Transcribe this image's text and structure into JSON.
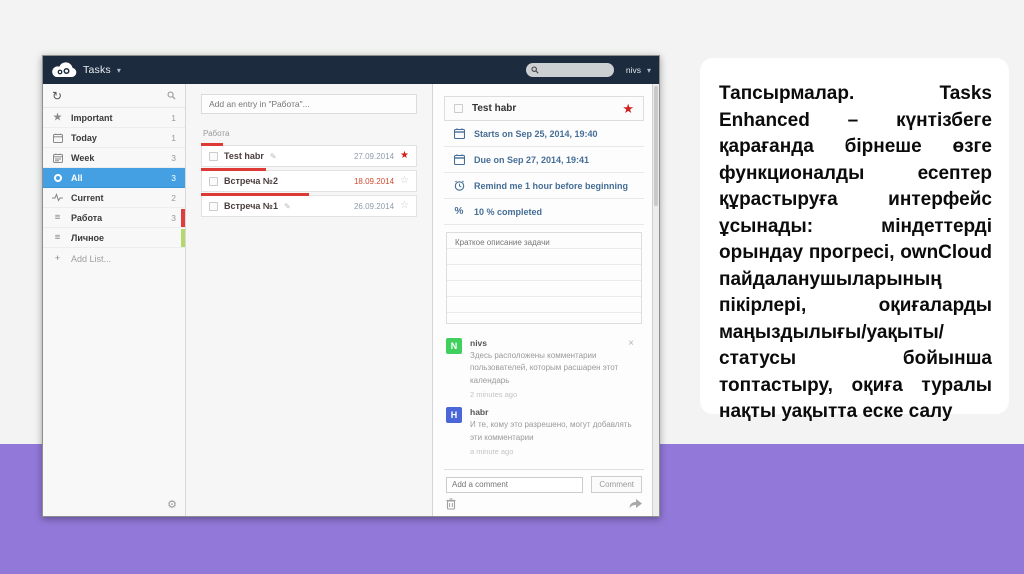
{
  "slide": {
    "description_text": "Тапсырмалар. Tasks Enhanced – күнтізбеге қарағанда бірнеше өзге функционалды есептер құрастыруға интерфейс ұсынады: міндеттерді орындау прогресі, ownCloud пайдаланушыларының пікірлері, оқиғаларды маңыздылығы/уақыты/статусы бойынша топтастыру, оқиға туралы нақты уақытта еске салу",
    "colors": {
      "band_purple": "#9278d9",
      "background_gray": "#f2f3f2",
      "card_white": "#ffffff"
    }
  },
  "icons": {
    "refresh": "↻",
    "caret": "▾",
    "star_filled": "★",
    "star_outline": "☆",
    "list": "≡",
    "plus": "+",
    "gear": "⚙",
    "pencil": "✎",
    "close": "×",
    "percent_sign": "%"
  },
  "app": {
    "colors": {
      "topbar_navy": "#1c2b3e",
      "selected_blue": "#44a0e2",
      "progress_red": "#dd3a35",
      "star_red": "#d01f1f",
      "overdue_red": "#d14a2e",
      "detail_blue": "#456e96",
      "avatar_green": "#41cf5e",
      "avatar_blue": "#4a66d8",
      "list_bar_red": "#e03c3c",
      "list_bar_green": "#b4d96a"
    },
    "topbar": {
      "app_title": "Tasks",
      "user": "nivs",
      "search_value": ""
    },
    "sidebar": {
      "items": [
        {
          "label": "Important",
          "count": "1"
        },
        {
          "label": "Today",
          "count": "1"
        },
        {
          "label": "Week",
          "count": "3"
        },
        {
          "label": "All",
          "count": "3"
        },
        {
          "label": "Current",
          "count": "2"
        },
        {
          "label": "Работа",
          "count": "3"
        },
        {
          "label": "Личное",
          "count": ""
        }
      ],
      "add_list_label": "Add List..."
    },
    "tasklist": {
      "add_placeholder": "Add an entry in \"Работа\"...",
      "group_label": "Работа",
      "tasks": [
        {
          "name": "Test habr",
          "date": "27.09.2014",
          "progress": 10
        },
        {
          "name": "Встреча №2",
          "date": "18.09.2014",
          "progress": 30
        },
        {
          "name": "Встреча №1",
          "date": "26.09.2014",
          "progress": 50
        }
      ]
    },
    "details": {
      "title": "Test habr",
      "rows": [
        {
          "text": "Starts on Sep 25, 2014, 19:40"
        },
        {
          "text": "Due on Sep 27, 2014, 19:41"
        },
        {
          "text": "Remind me 1 hour before beginning"
        },
        {
          "text": "10 % completed"
        }
      ],
      "notes_placeholder": "Краткое описание задачи",
      "comments": [
        {
          "initial": "N",
          "name": "nivs",
          "text": "Здесь расположены комментарии пользователей, которым расшарен этот календарь",
          "time": "2 minutes ago"
        },
        {
          "initial": "H",
          "name": "habr",
          "text": "И те, кому это разрешено, могут добавлять эти комментарии",
          "time": "a minute ago"
        }
      ],
      "comment_placeholder": "Add a comment",
      "comment_button": "Comment"
    }
  }
}
